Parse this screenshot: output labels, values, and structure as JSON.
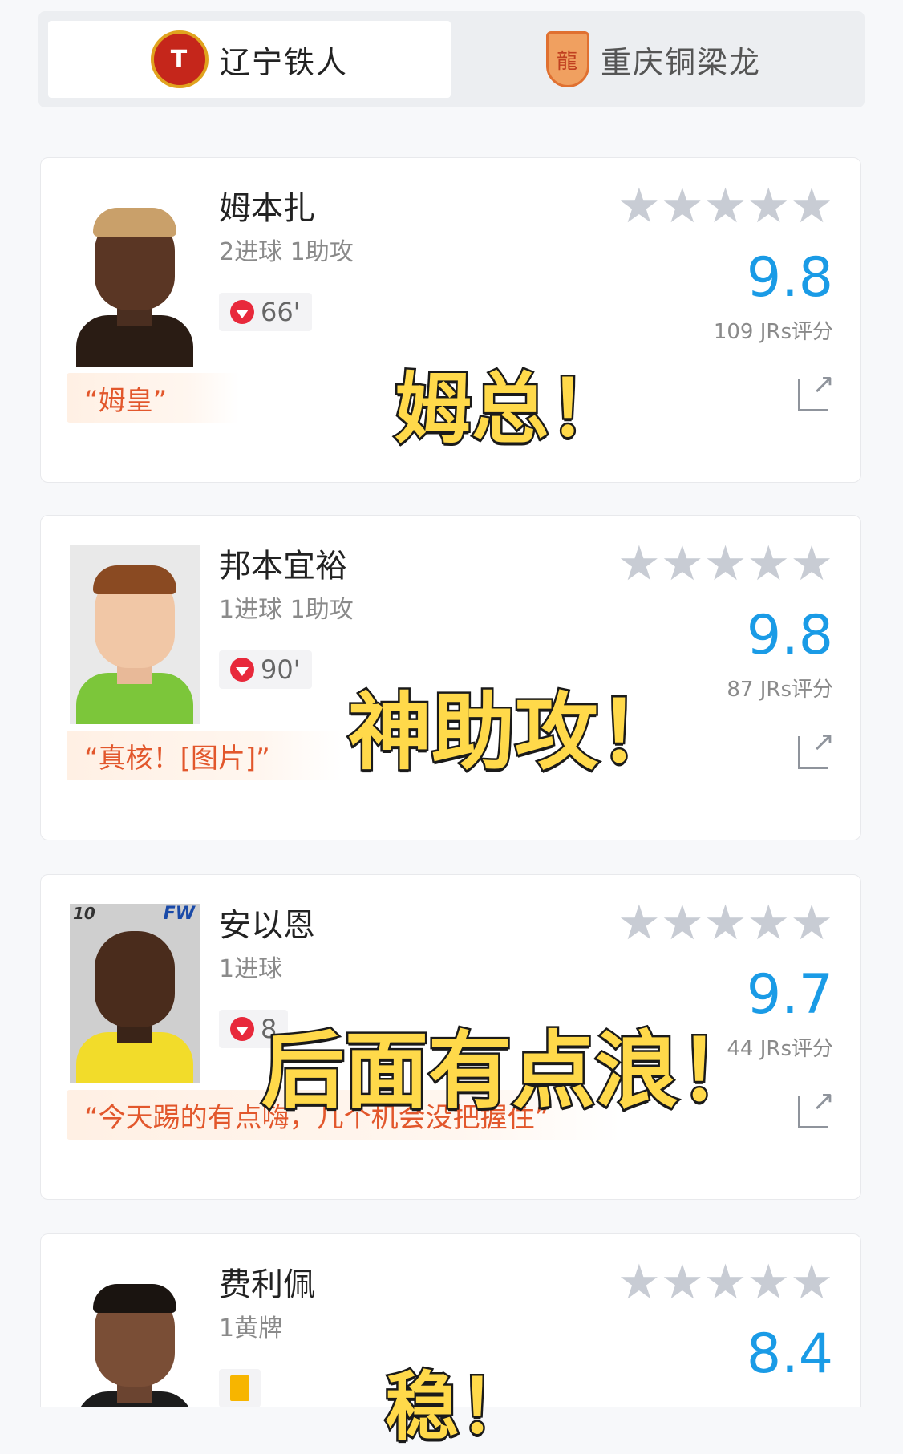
{
  "tabs": [
    {
      "label": "辽宁铁人",
      "badge_text": "T",
      "active": true
    },
    {
      "label": "重庆铜梁龙",
      "badge_text": "龍",
      "active": false
    }
  ],
  "players": [
    {
      "name": "姆本扎",
      "stats": "2进球 1助攻",
      "event": "66'",
      "event_type": "sub-off",
      "stars": "★★★★★",
      "score": "9.8",
      "jrs": "109 JRs评分",
      "quote": "“姆皇”",
      "caption": "姆总！"
    },
    {
      "name": "邦本宜裕",
      "stats": "1进球 1助攻",
      "event": "90'",
      "event_type": "sub-off",
      "stars": "★★★★★",
      "score": "9.8",
      "jrs": "87 JRs评分",
      "quote": "“真核！[图片]”",
      "caption": "神助攻！"
    },
    {
      "name": "安以恩",
      "stats": "1进球",
      "event": "8",
      "event_type": "sub-off",
      "stars": "★★★★★",
      "score": "9.7",
      "jrs": "44 JRs评分",
      "quote": "“今天踢的有点嗨，几个机会没把握住”",
      "caption": "后面有点浪！",
      "photo_number": "10",
      "photo_position": "FW"
    },
    {
      "name": "费利佩",
      "stats": "1黄牌",
      "event_type": "yellow-card",
      "stars": "★★★★★",
      "score": "8.4",
      "caption": "稳！"
    }
  ],
  "colors": {
    "score_blue": "#1a9be6",
    "quote_orange": "#e2572c",
    "caption_yellow": "#ffd94a",
    "sub_red": "#e8293b",
    "star_grey": "#c8ccd4"
  },
  "icons": [
    "liaoning-tieren-badge-icon",
    "chongqing-badge-icon",
    "sub-off-icon",
    "yellow-card-icon",
    "star-icon",
    "share-icon"
  ]
}
